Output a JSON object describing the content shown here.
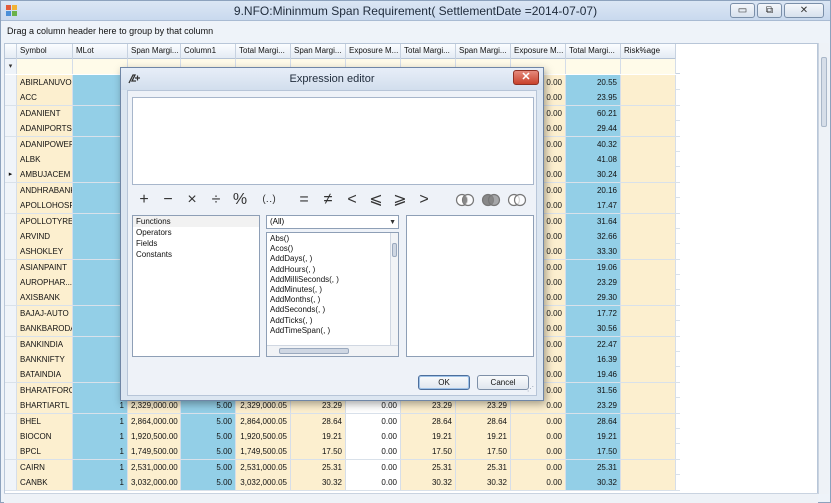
{
  "window": {
    "title": "9.NFO:Mininmum Span Requirement( SettlementDate =2014-07-07)",
    "minimize": "▭",
    "restore": "⧉",
    "close": "✕"
  },
  "groupbar": {
    "text": "Drag a column header here to group by that column"
  },
  "grid": {
    "columns": [
      "Symbol",
      "MLot",
      "Span Margi...",
      "Column1",
      "Total Margi...",
      "Span Margi...",
      "Exposure M...",
      "Total Margi...",
      "Span Margi...",
      "Exposure M...",
      "Total Margi...",
      "Risk%age"
    ],
    "filter_glyph": "▾",
    "current_row_glyph": "▸",
    "rows": [
      {
        "symbol": "ABIRLANUVO",
        "mlot": "",
        "span": "",
        "col1": "",
        "tm": "",
        "sm2": "",
        "exp": "",
        "tm2": "",
        "sm3": "",
        "exp2": "0.00",
        "tm3": "20.55",
        "risk": ""
      },
      {
        "symbol": "ACC",
        "mlot": "",
        "span": "",
        "col1": "",
        "tm": "",
        "sm2": "",
        "exp": "",
        "tm2": "",
        "sm3": "",
        "exp2": "0.00",
        "tm3": "23.95",
        "risk": ""
      },
      {
        "symbol": "ADANIENT",
        "mlot": "",
        "span": "",
        "col1": "",
        "tm": "",
        "sm2": "",
        "exp": "",
        "tm2": "",
        "sm3": "",
        "exp2": "0.00",
        "tm3": "60.21",
        "risk": ""
      },
      {
        "symbol": "ADANIPORTS",
        "mlot": "",
        "span": "",
        "col1": "",
        "tm": "",
        "sm2": "",
        "exp": "",
        "tm2": "",
        "sm3": "",
        "exp2": "0.00",
        "tm3": "29.44",
        "risk": ""
      },
      {
        "symbol": "ADANIPOWER",
        "mlot": "",
        "span": "",
        "col1": "",
        "tm": "",
        "sm2": "",
        "exp": "",
        "tm2": "",
        "sm3": "",
        "exp2": "0.00",
        "tm3": "40.32",
        "risk": ""
      },
      {
        "symbol": "ALBK",
        "mlot": "",
        "span": "",
        "col1": "",
        "tm": "",
        "sm2": "",
        "exp": "",
        "tm2": "",
        "sm3": "",
        "exp2": "0.00",
        "tm3": "41.08",
        "risk": ""
      },
      {
        "symbol": "AMBUJACEM",
        "mlot": "",
        "span": "",
        "col1": "",
        "tm": "",
        "sm2": "",
        "exp": "",
        "tm2": "",
        "sm3": "",
        "exp2": "0.00",
        "tm3": "30.24",
        "risk": "",
        "current": true
      },
      {
        "symbol": "ANDHRABANK",
        "mlot": "",
        "span": "",
        "col1": "",
        "tm": "",
        "sm2": "",
        "exp": "",
        "tm2": "",
        "sm3": "",
        "exp2": "0.00",
        "tm3": "20.16",
        "risk": ""
      },
      {
        "symbol": "APOLLOHOSP",
        "mlot": "",
        "span": "",
        "col1": "",
        "tm": "",
        "sm2": "",
        "exp": "",
        "tm2": "",
        "sm3": "",
        "exp2": "0.00",
        "tm3": "17.47",
        "risk": ""
      },
      {
        "symbol": "APOLLOTYRE",
        "mlot": "",
        "span": "",
        "col1": "",
        "tm": "",
        "sm2": "",
        "exp": "",
        "tm2": "",
        "sm3": "",
        "exp2": "0.00",
        "tm3": "31.64",
        "risk": ""
      },
      {
        "symbol": "ARVIND",
        "mlot": "",
        "span": "",
        "col1": "",
        "tm": "",
        "sm2": "",
        "exp": "",
        "tm2": "",
        "sm3": "",
        "exp2": "0.00",
        "tm3": "32.66",
        "risk": ""
      },
      {
        "symbol": "ASHOKLEY",
        "mlot": "",
        "span": "",
        "col1": "",
        "tm": "",
        "sm2": "",
        "exp": "",
        "tm2": "",
        "sm3": "",
        "exp2": "0.00",
        "tm3": "33.30",
        "risk": ""
      },
      {
        "symbol": "ASIANPAINT",
        "mlot": "",
        "span": "",
        "col1": "",
        "tm": "",
        "sm2": "",
        "exp": "",
        "tm2": "",
        "sm3": "",
        "exp2": "0.00",
        "tm3": "19.06",
        "risk": ""
      },
      {
        "symbol": "AUROPHAR...",
        "mlot": "",
        "span": "",
        "col1": "",
        "tm": "",
        "sm2": "",
        "exp": "",
        "tm2": "",
        "sm3": "",
        "exp2": "0.00",
        "tm3": "23.29",
        "risk": ""
      },
      {
        "symbol": "AXISBANK",
        "mlot": "",
        "span": "",
        "col1": "",
        "tm": "",
        "sm2": "",
        "exp": "",
        "tm2": "",
        "sm3": "",
        "exp2": "0.00",
        "tm3": "29.30",
        "risk": ""
      },
      {
        "symbol": "BAJAJ-AUTO",
        "mlot": "",
        "span": "",
        "col1": "",
        "tm": "",
        "sm2": "",
        "exp": "",
        "tm2": "",
        "sm3": "",
        "exp2": "0.00",
        "tm3": "17.72",
        "risk": ""
      },
      {
        "symbol": "BANKBARODA",
        "mlot": "",
        "span": "",
        "col1": "",
        "tm": "",
        "sm2": "",
        "exp": "",
        "tm2": "",
        "sm3": "",
        "exp2": "0.00",
        "tm3": "30.56",
        "risk": ""
      },
      {
        "symbol": "BANKINDIA",
        "mlot": "",
        "span": "",
        "col1": "",
        "tm": "",
        "sm2": "",
        "exp": "",
        "tm2": "",
        "sm3": "",
        "exp2": "0.00",
        "tm3": "22.47",
        "risk": ""
      },
      {
        "symbol": "BANKNIFTY",
        "mlot": "",
        "span": "",
        "col1": "",
        "tm": "",
        "sm2": "",
        "exp": "",
        "tm2": "",
        "sm3": "",
        "exp2": "0.00",
        "tm3": "16.39",
        "risk": ""
      },
      {
        "symbol": "BATAINDIA",
        "mlot": "",
        "span": "",
        "col1": "",
        "tm": "",
        "sm2": "",
        "exp": "",
        "tm2": "",
        "sm3": "",
        "exp2": "0.00",
        "tm3": "19.46",
        "risk": ""
      },
      {
        "symbol": "BHARATFORG",
        "mlot": "",
        "span": "",
        "col1": "",
        "tm": "",
        "sm2": "",
        "exp": "",
        "tm2": "",
        "sm3": "",
        "exp2": "0.00",
        "tm3": "31.56",
        "risk": ""
      },
      {
        "symbol": "BHARTIARTL",
        "mlot": "1",
        "span": "2,329,000.00",
        "col1": "5.00",
        "tm": "2,329,000.05",
        "sm2": "23.29",
        "exp": "0.00",
        "tm2": "23.29",
        "sm3": "23.29",
        "exp2": "0.00",
        "tm3": "23.29",
        "risk": ""
      },
      {
        "symbol": "BHEL",
        "mlot": "1",
        "span": "2,864,000.00",
        "col1": "5.00",
        "tm": "2,864,000.05",
        "sm2": "28.64",
        "exp": "0.00",
        "tm2": "28.64",
        "sm3": "28.64",
        "exp2": "0.00",
        "tm3": "28.64",
        "risk": ""
      },
      {
        "symbol": "BIOCON",
        "mlot": "1",
        "span": "1,920,500.00",
        "col1": "5.00",
        "tm": "1,920,500.05",
        "sm2": "19.21",
        "exp": "0.00",
        "tm2": "19.21",
        "sm3": "19.21",
        "exp2": "0.00",
        "tm3": "19.21",
        "risk": ""
      },
      {
        "symbol": "BPCL",
        "mlot": "1",
        "span": "1,749,500.00",
        "col1": "5.00",
        "tm": "1,749,500.05",
        "sm2": "17.50",
        "exp": "0.00",
        "tm2": "17.50",
        "sm3": "17.50",
        "exp2": "0.00",
        "tm3": "17.50",
        "risk": ""
      },
      {
        "symbol": "CAIRN",
        "mlot": "1",
        "span": "2,531,000.00",
        "col1": "5.00",
        "tm": "2,531,000.05",
        "sm2": "25.31",
        "exp": "0.00",
        "tm2": "25.31",
        "sm3": "25.31",
        "exp2": "0.00",
        "tm3": "25.31",
        "risk": ""
      },
      {
        "symbol": "CANBK",
        "mlot": "1",
        "span": "3,032,000.00",
        "col1": "5.00",
        "tm": "3,032,000.05",
        "sm2": "30.32",
        "exp": "0.00",
        "tm2": "30.32",
        "sm3": "30.32",
        "exp2": "0.00",
        "tm3": "30.32",
        "risk": ""
      }
    ]
  },
  "dialog": {
    "title": "Expression editor",
    "close": "✕",
    "expression_value": "",
    "operators": [
      "+",
      "−",
      "×",
      "÷",
      "%",
      "(‥)",
      "=",
      "≠",
      "<",
      "⩽",
      "⩾",
      ">"
    ],
    "categories": [
      "Functions",
      "Operators",
      "Fields",
      "Constants"
    ],
    "filter_value": "(All)",
    "functions": [
      "Abs()",
      "Acos()",
      "AddDays(, )",
      "AddHours(, )",
      "AddMilliSeconds(, )",
      "AddMinutes(, )",
      "AddMonths(, )",
      "AddSeconds(, )",
      "AddTicks(, )",
      "AddTimeSpan(, )"
    ],
    "ok_label": "OK",
    "cancel_label": "Cancel",
    "description": ""
  },
  "colors": {
    "blue_cell": "#93cfe7",
    "cream_cell": "#fcefcf",
    "close_red": "#c9422c"
  }
}
